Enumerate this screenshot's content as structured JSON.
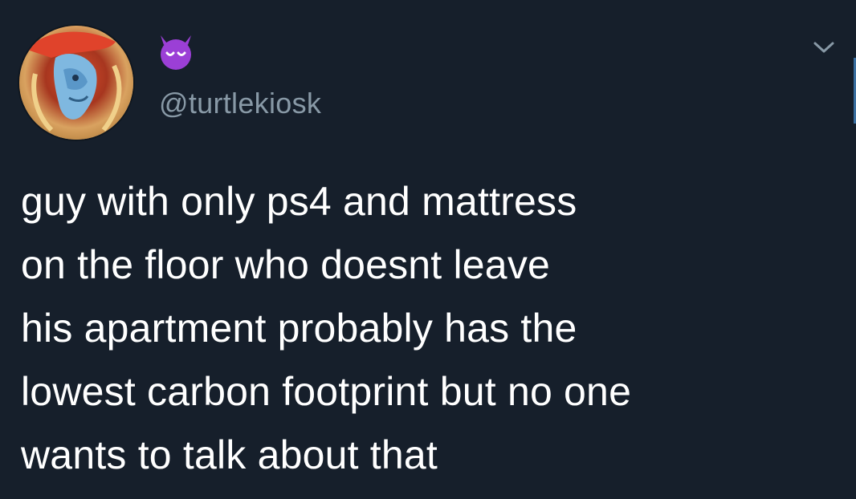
{
  "tweet": {
    "handle": "@turtlekiosk",
    "text": "guy with only ps4 and mattress\non the floor who doesnt leave\nhis apartment probably has the\nlowest carbon footprint but no one\nwants to talk about that"
  },
  "icons": {
    "display_name_emoji": "smiling-imp-icon",
    "more_menu": "chevron-down-icon"
  },
  "colors": {
    "background": "#161f2b",
    "text": "#ffffff",
    "handle": "#8899a6",
    "emoji": "#9b3fd6"
  }
}
